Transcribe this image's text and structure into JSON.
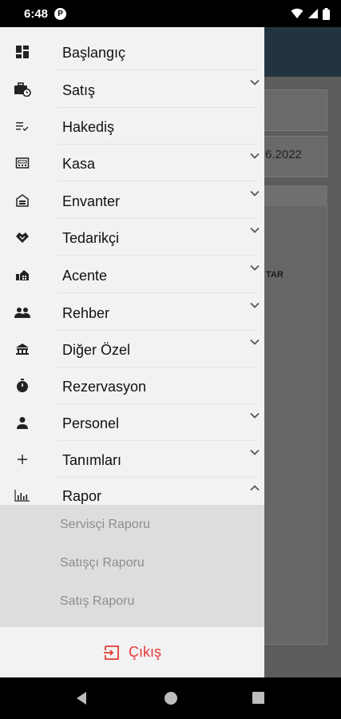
{
  "status_bar": {
    "time": "6:48",
    "app_icon_letter": "P"
  },
  "background": {
    "date_fragment": "6.2022",
    "column_fragment": "TAR"
  },
  "menu": {
    "items": [
      {
        "label": "Başlangıç",
        "icon": "dashboard-icon",
        "expandable": false
      },
      {
        "label": "Satış",
        "icon": "briefcase-clock-icon",
        "expandable": true
      },
      {
        "label": "Hakediş",
        "icon": "list-check-icon",
        "expandable": false
      },
      {
        "label": "Kasa",
        "icon": "cash-register-icon",
        "expandable": true
      },
      {
        "label": "Envanter",
        "icon": "warehouse-icon",
        "expandable": true
      },
      {
        "label": "Tedarikçi",
        "icon": "handshake-icon",
        "expandable": true
      },
      {
        "label": "Acente",
        "icon": "agency-icon",
        "expandable": true
      },
      {
        "label": "Rehber",
        "icon": "people-icon",
        "expandable": true
      },
      {
        "label": "Diğer Özel",
        "icon": "bank-icon",
        "expandable": true
      },
      {
        "label": "Rezervasyon",
        "icon": "stopwatch-icon",
        "expandable": false
      },
      {
        "label": "Personel",
        "icon": "person-icon",
        "expandable": true
      },
      {
        "label": "Tanımları",
        "icon": "plus-icon",
        "expandable": true
      },
      {
        "label": "Rapor",
        "icon": "bar-chart-icon",
        "expandable": true,
        "expanded": true
      }
    ],
    "rapor_subitems": [
      "Servisçi Raporu",
      "Satışçı Raporu",
      "Satış Raporu"
    ]
  },
  "logout": {
    "label": "Çıkış",
    "color": "#e53935"
  },
  "colors": {
    "drawer_bg": "#f2f2f3",
    "submenu_bg": "#dddddd",
    "appbar": "#22343f"
  }
}
